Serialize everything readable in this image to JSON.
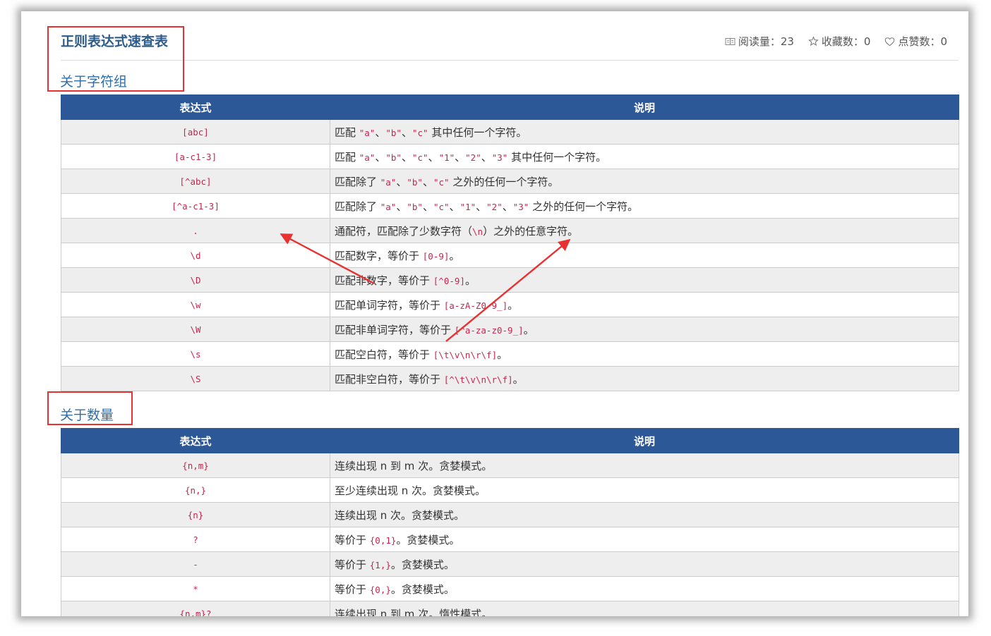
{
  "article": {
    "title": "正则表达式速查表",
    "meta": {
      "reads": "阅读量：23",
      "favorites": "收藏数：0",
      "likes": "点赞数：0"
    }
  },
  "sections": [
    {
      "heading": "关于字符组",
      "columns": [
        "表达式",
        "说明"
      ],
      "rows": [
        {
          "expr": "[abc]",
          "desc": [
            {
              "t": "匹配 "
            },
            {
              "c": "\"a\""
            },
            {
              "t": "、"
            },
            {
              "c": "\"b\""
            },
            {
              "t": "、"
            },
            {
              "c": "\"c\""
            },
            {
              "t": " 其中任何一个字符。"
            }
          ]
        },
        {
          "expr": "[a-c1-3]",
          "desc": [
            {
              "t": "匹配 "
            },
            {
              "c": "\"a\""
            },
            {
              "t": "、"
            },
            {
              "c": "\"b\""
            },
            {
              "t": "、"
            },
            {
              "c": "\"c\""
            },
            {
              "t": "、"
            },
            {
              "c": "\"1\""
            },
            {
              "t": "、"
            },
            {
              "c": "\"2\""
            },
            {
              "t": "、"
            },
            {
              "c": "\"3\""
            },
            {
              "t": " 其中任何一个字符。"
            }
          ]
        },
        {
          "expr": "[^abc]",
          "desc": [
            {
              "t": "匹配除了 "
            },
            {
              "c": "\"a\""
            },
            {
              "t": "、"
            },
            {
              "c": "\"b\""
            },
            {
              "t": "、"
            },
            {
              "c": "\"c\""
            },
            {
              "t": " 之外的任何一个字符。"
            }
          ]
        },
        {
          "expr": "[^a-c1-3]",
          "desc": [
            {
              "t": "匹配除了 "
            },
            {
              "c": "\"a\""
            },
            {
              "t": "、"
            },
            {
              "c": "\"b\""
            },
            {
              "t": "、"
            },
            {
              "c": "\"c\""
            },
            {
              "t": "、"
            },
            {
              "c": "\"1\""
            },
            {
              "t": "、"
            },
            {
              "c": "\"2\""
            },
            {
              "t": "、"
            },
            {
              "c": "\"3\""
            },
            {
              "t": " 之外的任何一个字符。"
            }
          ]
        },
        {
          "expr": ".",
          "desc": [
            {
              "t": "通配符，匹配除了少数字符（"
            },
            {
              "c": "\\n"
            },
            {
              "t": "）之外的任意字符。"
            }
          ]
        },
        {
          "expr": "\\d",
          "desc": [
            {
              "t": "匹配数字，等价于 "
            },
            {
              "c": "[0-9]"
            },
            {
              "t": "。"
            }
          ]
        },
        {
          "expr": "\\D",
          "desc": [
            {
              "t": "匹配非数字，等价于 "
            },
            {
              "c": "[^0-9]"
            },
            {
              "t": "。"
            }
          ]
        },
        {
          "expr": "\\w",
          "desc": [
            {
              "t": "匹配单词字符，等价于 "
            },
            {
              "c": "[a-zA-Z0-9_]"
            },
            {
              "t": "。"
            }
          ]
        },
        {
          "expr": "\\W",
          "desc": [
            {
              "t": "匹配非单词字符，等价于 "
            },
            {
              "c": "[^a-za-z0-9_]"
            },
            {
              "t": "。"
            }
          ]
        },
        {
          "expr": "\\s",
          "desc": [
            {
              "t": "匹配空白符，等价于 "
            },
            {
              "c": "[\\t\\v\\n\\r\\f]"
            },
            {
              "t": "。"
            }
          ]
        },
        {
          "expr": "\\S",
          "desc": [
            {
              "t": "匹配非空白符，等价于 "
            },
            {
              "c": "[^\\t\\v\\n\\r\\f]"
            },
            {
              "t": "。"
            }
          ]
        }
      ]
    },
    {
      "heading": "关于数量",
      "columns": [
        "表达式",
        "说明"
      ],
      "rows": [
        {
          "expr": "{n,m}",
          "desc": [
            {
              "t": "连续出现 n 到 m 次。贪婪模式。"
            }
          ]
        },
        {
          "expr": "{n,}",
          "desc": [
            {
              "t": "至少连续出现 n 次。贪婪模式。"
            }
          ]
        },
        {
          "expr": "{n}",
          "desc": [
            {
              "t": "连续出现 n 次。贪婪模式。"
            }
          ]
        },
        {
          "expr": "?",
          "desc": [
            {
              "t": "等价于 "
            },
            {
              "c": "{0,1}"
            },
            {
              "t": "。贪婪模式。"
            }
          ]
        },
        {
          "expr": "-",
          "desc": [
            {
              "t": "等价于 "
            },
            {
              "c": "{1,}"
            },
            {
              "t": "。贪婪模式。"
            }
          ]
        },
        {
          "expr": "*",
          "desc": [
            {
              "t": "等价于 "
            },
            {
              "c": "{0,}"
            },
            {
              "t": "。贪婪模式。"
            }
          ]
        },
        {
          "expr": "{n,m}?",
          "desc": [
            {
              "t": "连续出现 n 到 m 次。惰性模式。"
            }
          ]
        }
      ]
    }
  ],
  "colors": {
    "header_bg": "#2c5898",
    "code_text": "#c7254e",
    "heading_text": "#2e6fa8",
    "annotation_red": "#e83131"
  }
}
